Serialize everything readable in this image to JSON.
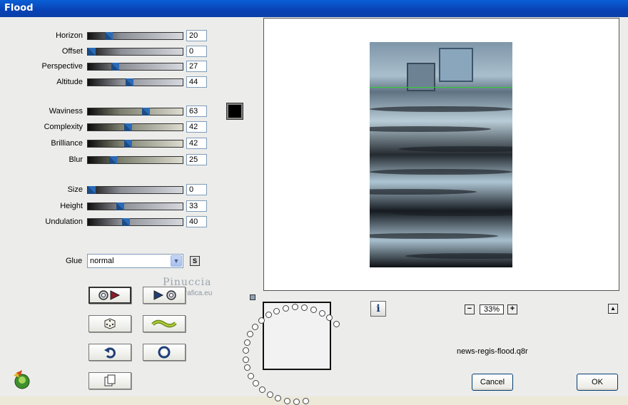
{
  "window": {
    "title": "Flood"
  },
  "sliders": [
    {
      "id": "horizon",
      "label": "Horizon",
      "value": "20",
      "level": 0.2
    },
    {
      "id": "offset",
      "label": "Offset",
      "value": "0",
      "level": 0.0
    },
    {
      "id": "perspective",
      "label": "Perspective",
      "value": "27",
      "level": 0.27
    },
    {
      "id": "altitude",
      "label": "Altitude",
      "value": "44",
      "level": 0.44
    },
    {
      "id": "waviness",
      "label": "Waviness",
      "value": "63",
      "level": 0.63
    },
    {
      "id": "complexity",
      "label": "Complexity",
      "value": "42",
      "level": 0.42
    },
    {
      "id": "brilliance",
      "label": "Brilliance",
      "value": "42",
      "level": 0.42
    },
    {
      "id": "blur",
      "label": "Blur",
      "value": "25",
      "level": 0.25
    },
    {
      "id": "size",
      "label": "Size",
      "value": "0",
      "level": 0.0
    },
    {
      "id": "height",
      "label": "Height",
      "value": "33",
      "level": 0.33
    },
    {
      "id": "undulation",
      "label": "Undulation",
      "value": "40",
      "level": 0.4
    }
  ],
  "color": {
    "swatch": "#000000"
  },
  "glue": {
    "label": "Glue",
    "value": "normal",
    "s_label": "S"
  },
  "tools": [
    "preview-icon",
    "play-icon",
    "dice-icon",
    "wave-icon",
    "undo-icon",
    "reset-icon",
    "copy-icon"
  ],
  "zoom": {
    "value": "33%",
    "minus": "−",
    "plus": "+"
  },
  "info_label": "i",
  "scroll_label": "▲",
  "filename": "news-regis-flood.q8r",
  "buttons": {
    "cancel": "Cancel",
    "ok": "OK"
  },
  "watermark": {
    "line1": "Pinuccia",
    "line2": "www.ludicregrafica.eu"
  },
  "accent": {
    "titlebar": "#0842b5",
    "thumb": "#1c4c86"
  }
}
